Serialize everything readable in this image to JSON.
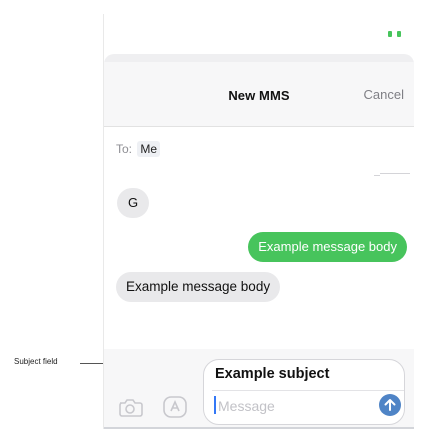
{
  "header": {
    "title": "New MMS",
    "cancel_label": "Cancel"
  },
  "to": {
    "label": "To:",
    "recipient": "Me"
  },
  "messages": [
    {
      "direction": "received",
      "text": "G"
    },
    {
      "direction": "sent",
      "text": "Example message body"
    },
    {
      "direction": "received",
      "text": "Example message body"
    }
  ],
  "compose": {
    "subject_value": "Example subject",
    "message_placeholder": "Message"
  },
  "annotation": {
    "label": "Subject field"
  },
  "colors": {
    "sent_bubble": "#47c45c",
    "received_bubble": "#e9e9eb",
    "send_button": "#4f84c6",
    "accent": "#3478f6"
  },
  "icons": {
    "status": "battery-icon",
    "camera": "camera-icon",
    "apps": "appstore-icon",
    "send": "arrow-up-icon"
  }
}
